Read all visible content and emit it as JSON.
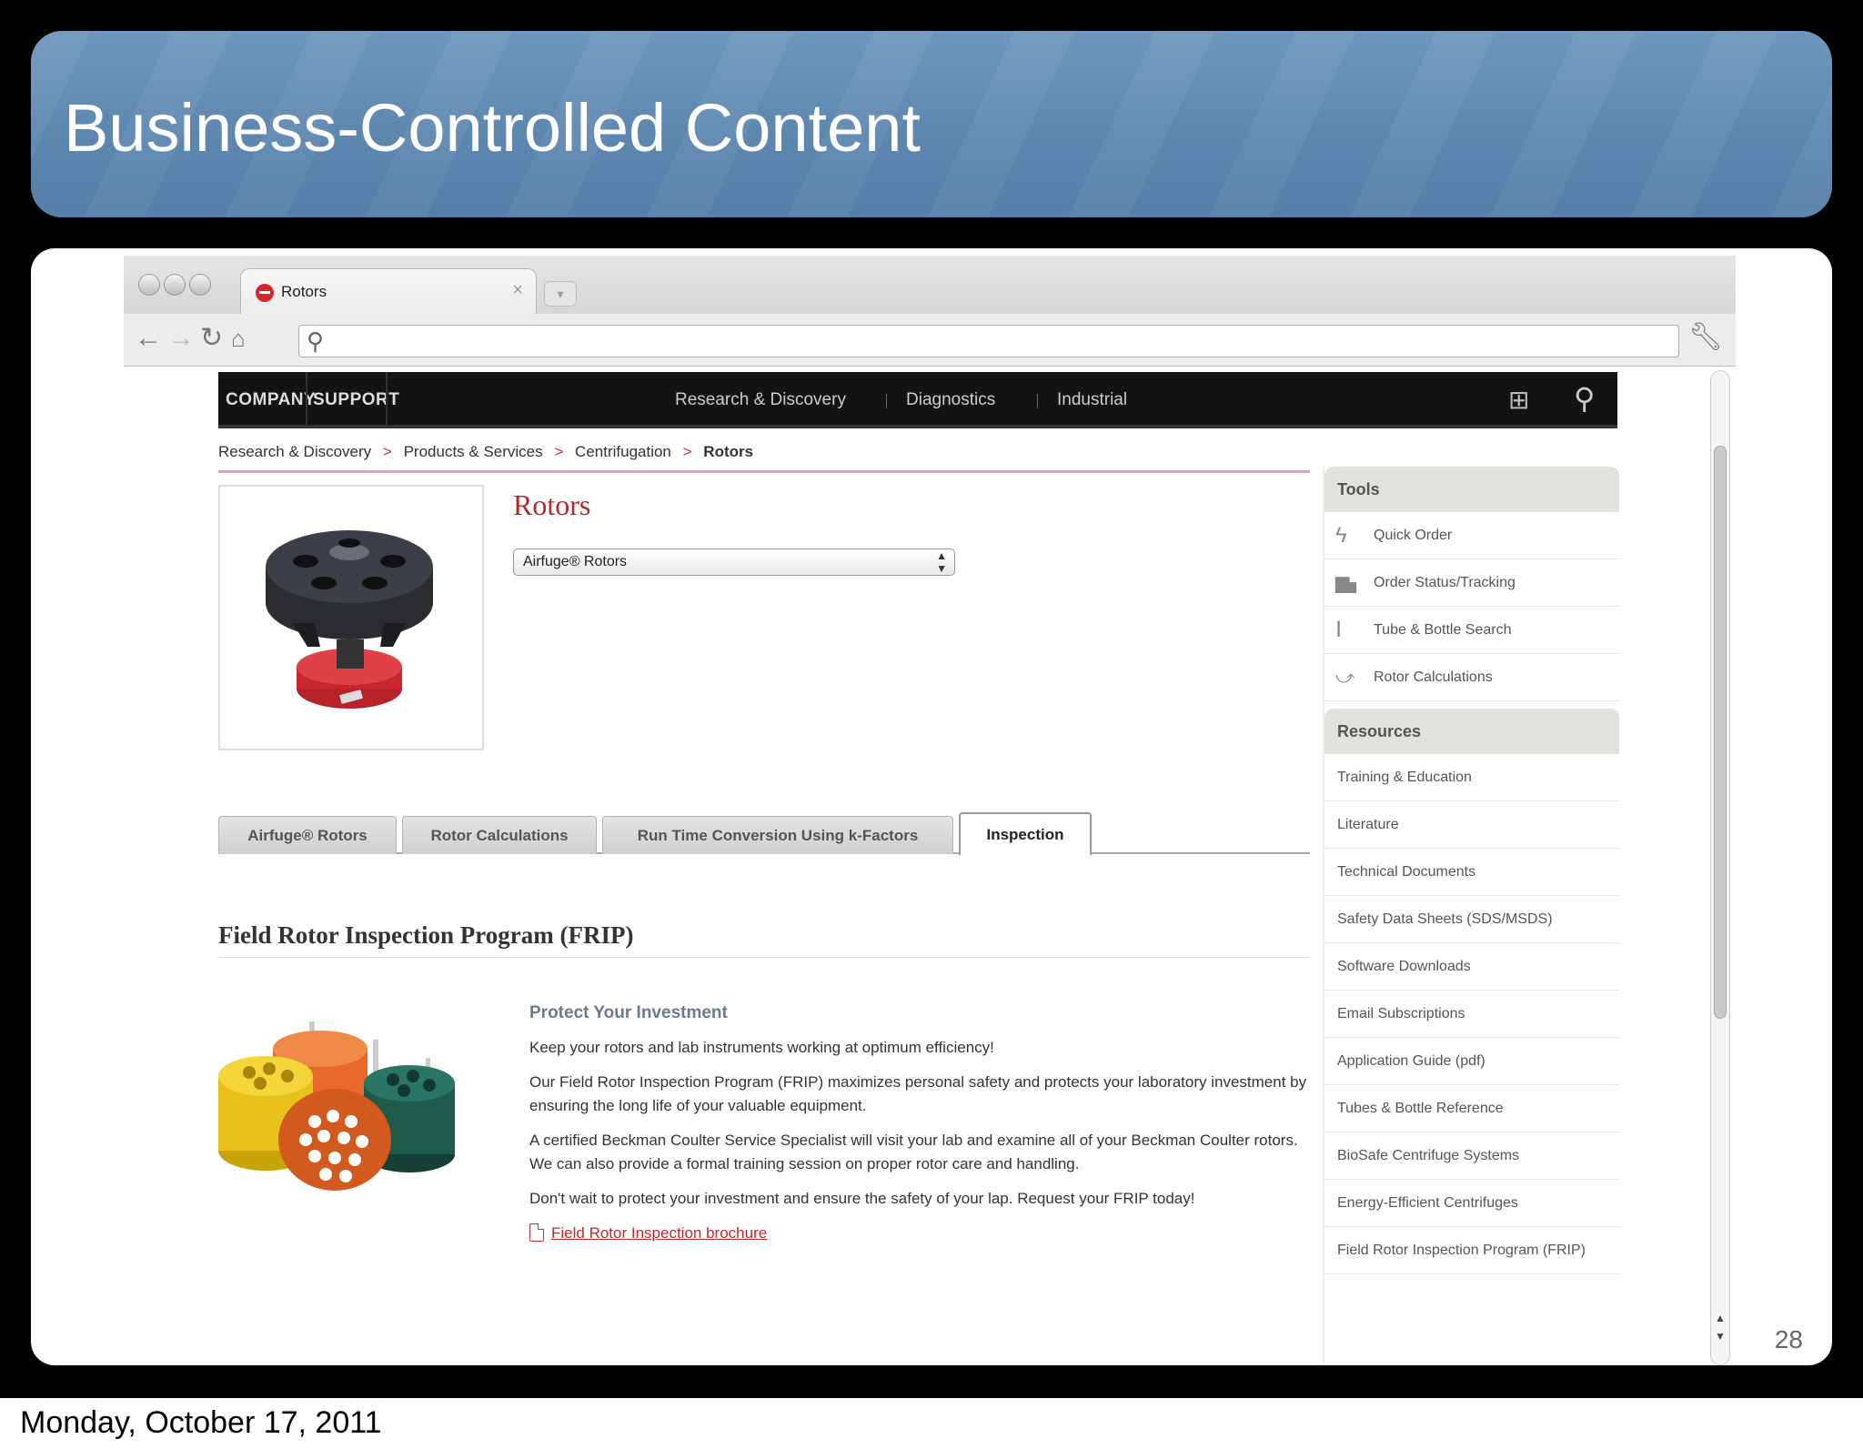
{
  "slide": {
    "title": "Business-Controlled Content",
    "number": "28",
    "footer_date": "Monday, October 17, 2011",
    "accent": "#5e87b0"
  },
  "browser": {
    "tab_title": "Rotors",
    "tab_close": "×",
    "omnibox_value": ""
  },
  "site": {
    "nav_left": [
      "COMPANY",
      "SUPPORT"
    ],
    "nav_mid": [
      "Research & Discovery",
      "Diagnostics",
      "Industrial"
    ],
    "brand_color": "#b22a2a"
  },
  "breadcrumb": {
    "items": [
      "Research & Discovery",
      "Products & Services",
      "Centrifugation",
      "Rotors"
    ],
    "separator": ">"
  },
  "product": {
    "title": "Rotors",
    "select_value": "Airfuge® Rotors",
    "tabs": [
      {
        "label": "Airfuge® Rotors",
        "active": false
      },
      {
        "label": "Rotor Calculations",
        "active": false
      },
      {
        "label": "Run Time Conversion Using k-Factors",
        "active": false
      },
      {
        "label": "Inspection",
        "active": true
      }
    ]
  },
  "frip": {
    "heading": "Field Rotor Inspection Program (FRIP)",
    "subhead": "Protect Your Investment",
    "paragraphs": [
      "Keep your rotors and lab instruments working at optimum efficiency!",
      "Our Field Rotor Inspection Program (FRIP) maximizes personal safety and protects your laboratory investment by ensuring the long life of your valuable equipment.",
      "A certified Beckman Coulter Service Specialist will visit your lab and examine all of your Beckman Coulter rotors. We can also provide a formal training session on proper rotor care and handling.",
      "Don't wait to protect your investment and ensure the safety of your lap. Request your FRIP today!"
    ],
    "link": "Field Rotor Inspection brochure"
  },
  "sidebar": {
    "tools_heading": "Tools",
    "tools": [
      {
        "label": "Quick Order",
        "icon": "lightning-icon"
      },
      {
        "label": "Order Status/Tracking",
        "icon": "truck-icon"
      },
      {
        "label": "Tube & Bottle Search",
        "icon": "tube-icon"
      },
      {
        "label": "Rotor Calculations",
        "icon": "calculation-icon"
      }
    ],
    "resources_heading": "Resources",
    "resources": [
      "Training & Education",
      "Literature",
      "Technical Documents",
      "Safety Data Sheets (SDS/MSDS)",
      "Software Downloads",
      "Email Subscriptions",
      "Application Guide (pdf)",
      "Tubes & Bottle Reference",
      "BioSafe Centrifuge Systems",
      "Energy-Efficient Centrifuges",
      "Field Rotor Inspection Program (FRIP)"
    ]
  }
}
